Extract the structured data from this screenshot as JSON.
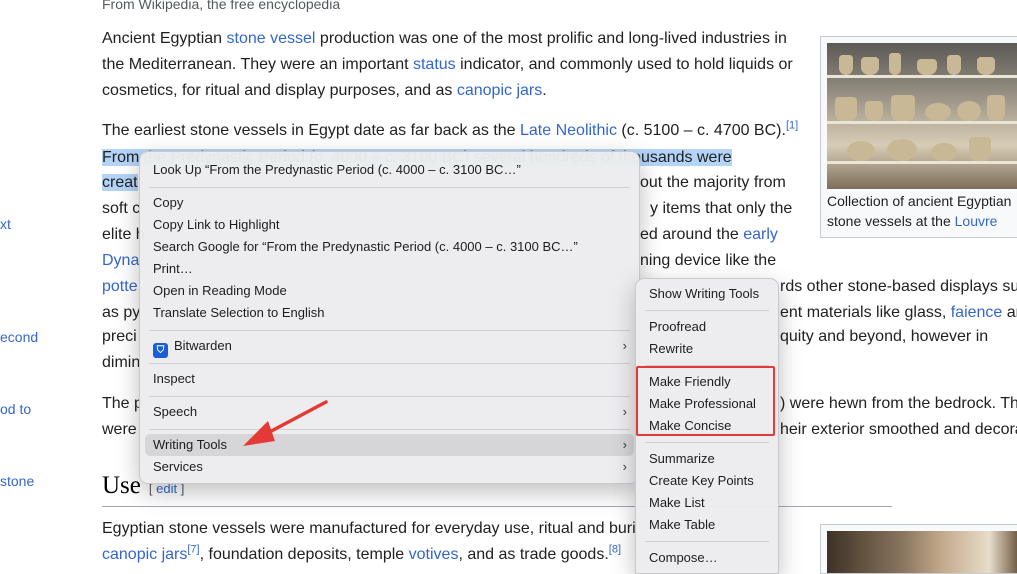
{
  "left_nav": {
    "items": [
      "xt",
      "econd",
      "od to",
      "stone"
    ]
  },
  "article": {
    "top_fragment": "From Wikipedia, the free encyclopedia",
    "p1": {
      "l1a": "Ancient Egyptian ",
      "l1_link": "stone vessel",
      "l1b": " production was one of the most prolific and long-lived industries in",
      "l2a": "the Mediterranean. They were an important ",
      "l2_link": "status",
      "l2b": " indicator, and commonly used to hold liquids or",
      "l3a": "cosmetics, for ritual and display purposes, and as ",
      "l3_link": "canopic jars",
      "l3b": "."
    },
    "p2": {
      "l1a": "The earliest stone vessels in Egypt date as far back as the ",
      "l1_link": "Late Neolithic",
      "l1b": " (c. 5100 – c. 4700 BC).",
      "l1_ref": "[1]",
      "l2_sel": "From the Predynastic Period (c. 4000 – c. 3100 BC) several hundreds of thousands were",
      "l3a": "creat",
      "l3b": "out the majority from",
      "l4a": "soft c",
      "l4b": "y items that only the",
      "l5a": "elite h",
      "l5b": "ed around the ",
      "l5_link": "early",
      "l6a": "Dyna",
      "l6b": "ning device like the",
      "l7a": "potte",
      "l7b": "rds other stone-based displays su",
      "l8a": "as py",
      "l8b": "ent materials like glass, ",
      "l8_link": "faience",
      "l8c": " an",
      "l9a": "preci",
      "l9b": "quity and beyond, however in",
      "l10a": "dimin"
    },
    "p3": {
      "l1a": "The p",
      "l1b": ") were hewn from the bedrock. Th",
      "l2a": "were",
      "l2b": "heir exterior smoothed and decora"
    },
    "heading": "Use",
    "edit_label": "edit",
    "p4": {
      "l1": "Egyptian stone vessels were manufactured for everyday use, ritual and buri",
      "l2_link": "canopic jars",
      "l2_ref1": "[7]",
      "l2a": ", foundation deposits, temple ",
      "l2_link2": "votives",
      "l2b": ", and as trade goods.",
      "l2_ref2": "[8]"
    }
  },
  "infobox": {
    "caption_a": "Collection of ancient Egyptian",
    "caption_b": "stone vessels at the ",
    "caption_link": "Louvre"
  },
  "context_menu": {
    "look_up": "Look Up “From the Predynastic Period (c. 4000 – c. 3100 BC…”",
    "copy": "Copy",
    "copy_link": "Copy Link to Highlight",
    "search_google": "Search Google for “From the Predynastic Period (c. 4000 – c. 3100 BC…”",
    "print": "Print…",
    "reading_mode": "Open in Reading Mode",
    "translate": "Translate Selection to English",
    "bitwarden": "Bitwarden",
    "inspect": "Inspect",
    "speech": "Speech",
    "writing_tools": "Writing Tools",
    "services": "Services"
  },
  "writing_tools_menu": {
    "show": "Show Writing Tools",
    "proofread": "Proofread",
    "rewrite": "Rewrite",
    "friendly": "Make Friendly",
    "professional": "Make Professional",
    "concise": "Make Concise",
    "summarize": "Summarize",
    "key_points": "Create Key Points",
    "list": "Make List",
    "table": "Make Table",
    "compose": "Compose…"
  },
  "annotation": {
    "arrow_color": "#e53935",
    "highlight_box_color": "#e53935"
  }
}
